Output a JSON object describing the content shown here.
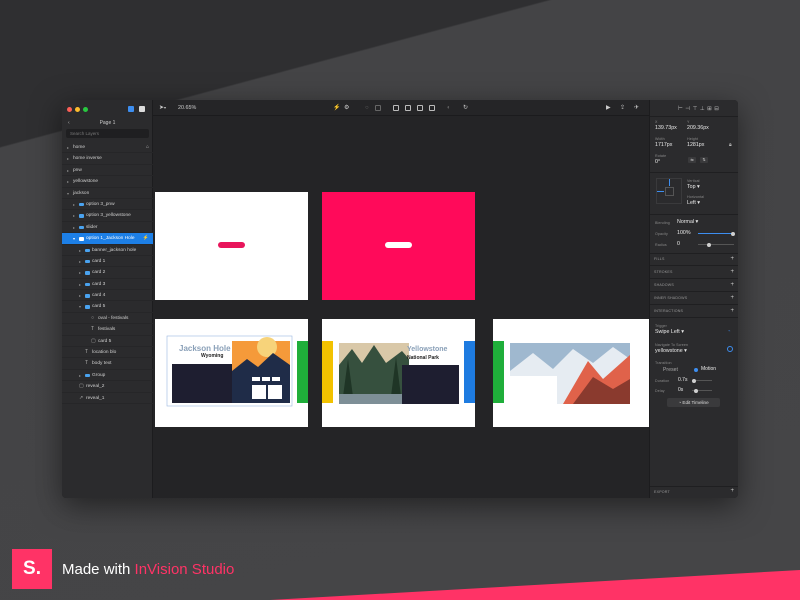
{
  "left_panel": {
    "page_title": "Page 1",
    "search_placeholder": "Search Layers",
    "layers": [
      {
        "label": "home",
        "level": 0,
        "arrow": "▸",
        "icon": ""
      },
      {
        "label": "home inverse",
        "level": 0,
        "arrow": "▸",
        "icon": ""
      },
      {
        "label": "pnw",
        "level": 0,
        "arrow": "▸",
        "icon": ""
      },
      {
        "label": "yellowstone",
        "level": 0,
        "arrow": "▸",
        "icon": ""
      },
      {
        "label": "jackson",
        "level": 0,
        "arrow": "▾",
        "icon": ""
      },
      {
        "label": "option 3_pnw",
        "level": 1,
        "arrow": "▸",
        "icon": "folder"
      },
      {
        "label": "option 3_yellowstone",
        "level": 1,
        "arrow": "▸",
        "icon": "folder"
      },
      {
        "label": "slider",
        "level": 1,
        "arrow": "▸",
        "icon": "folder"
      },
      {
        "label": "option 1_Jackson Hole",
        "level": 1,
        "arrow": "▾",
        "icon": "folder",
        "selected": true
      },
      {
        "label": "banner_jackson hole",
        "level": 2,
        "arrow": "▸",
        "icon": "folder"
      },
      {
        "label": "card 1",
        "level": 2,
        "arrow": "▸",
        "icon": "folder"
      },
      {
        "label": "card 2",
        "level": 2,
        "arrow": "▸",
        "icon": "folder"
      },
      {
        "label": "card 3",
        "level": 2,
        "arrow": "▸",
        "icon": "folder"
      },
      {
        "label": "card 4",
        "level": 2,
        "arrow": "▸",
        "icon": "folder"
      },
      {
        "label": "card 5",
        "level": 2,
        "arrow": "▾",
        "icon": "folder"
      },
      {
        "label": "oval - festivals",
        "level": 3,
        "arrow": "",
        "icon": "oval"
      },
      {
        "label": "festivals",
        "level": 3,
        "arrow": "",
        "icon": "text"
      },
      {
        "label": "card 5",
        "level": 3,
        "arrow": "",
        "icon": "rect"
      },
      {
        "label": "location blo",
        "level": 2,
        "arrow": "",
        "icon": "text"
      },
      {
        "label": "body text",
        "level": 2,
        "arrow": "",
        "icon": "text"
      },
      {
        "label": "Group",
        "level": 2,
        "arrow": "▸",
        "icon": "folder"
      },
      {
        "label": "reveal_2",
        "level": 1,
        "arrow": "",
        "icon": "rect"
      },
      {
        "label": "reveal_1",
        "level": 1,
        "arrow": "",
        "icon": "path"
      }
    ]
  },
  "toolbar": {
    "zoom": "20.65%"
  },
  "canvas": {
    "card_jackson": {
      "title": "Jackson Hole",
      "subtitle": "Wyoming"
    },
    "card_yellowstone": {
      "title": "Yellowstone",
      "subtitle": "National Park"
    },
    "accent_pink": "#ff0a5a",
    "accent_green": "#1fae3a",
    "accent_blue": "#1e7be0",
    "accent_yellow": "#f2c200"
  },
  "right_panel": {
    "x_label": "X",
    "x_value": "139.73px",
    "y_label": "Y",
    "y_value": "209.36px",
    "w_label": "Width",
    "w_value": "1717px",
    "h_label": "Height",
    "h_value": "1281px",
    "rot_label": "Rotate",
    "rot_value": "0°",
    "vert_label": "Vertical",
    "vert_value": "Top ▾",
    "horiz_label": "Horizontal",
    "horiz_value": "Left ▾",
    "blending_label": "Blending",
    "blending_value": "Normal ▾",
    "opacity_label": "Opacity",
    "opacity_value": "100%",
    "opacity": 1.0,
    "radius_label": "Radius",
    "radius_value": "0",
    "sections": [
      "FILLS",
      "STROKES",
      "SHADOWS",
      "INNER SHADOWS",
      "INTERACTIONS"
    ],
    "trigger_label": "Trigger",
    "trigger_value": "Swipe Left ▾",
    "navigate_label": "Navigate To Screen",
    "navigate_value": "yellowstone ▾",
    "transition_label": "Transition",
    "transition_preset": "Preset",
    "transition_motion": "Motion",
    "duration_label": "Duration",
    "duration_value": "0.7s",
    "duration": 0.7,
    "delay_label": "Delay",
    "delay_value": "0s",
    "delay": 0,
    "edit_timeline": "Edit Timeline",
    "export_label": "EXPORT"
  },
  "footer": {
    "logo": "S.",
    "made_with": "Made with ",
    "brand": "InVision Studio",
    "brand_color": "#ff3366"
  }
}
